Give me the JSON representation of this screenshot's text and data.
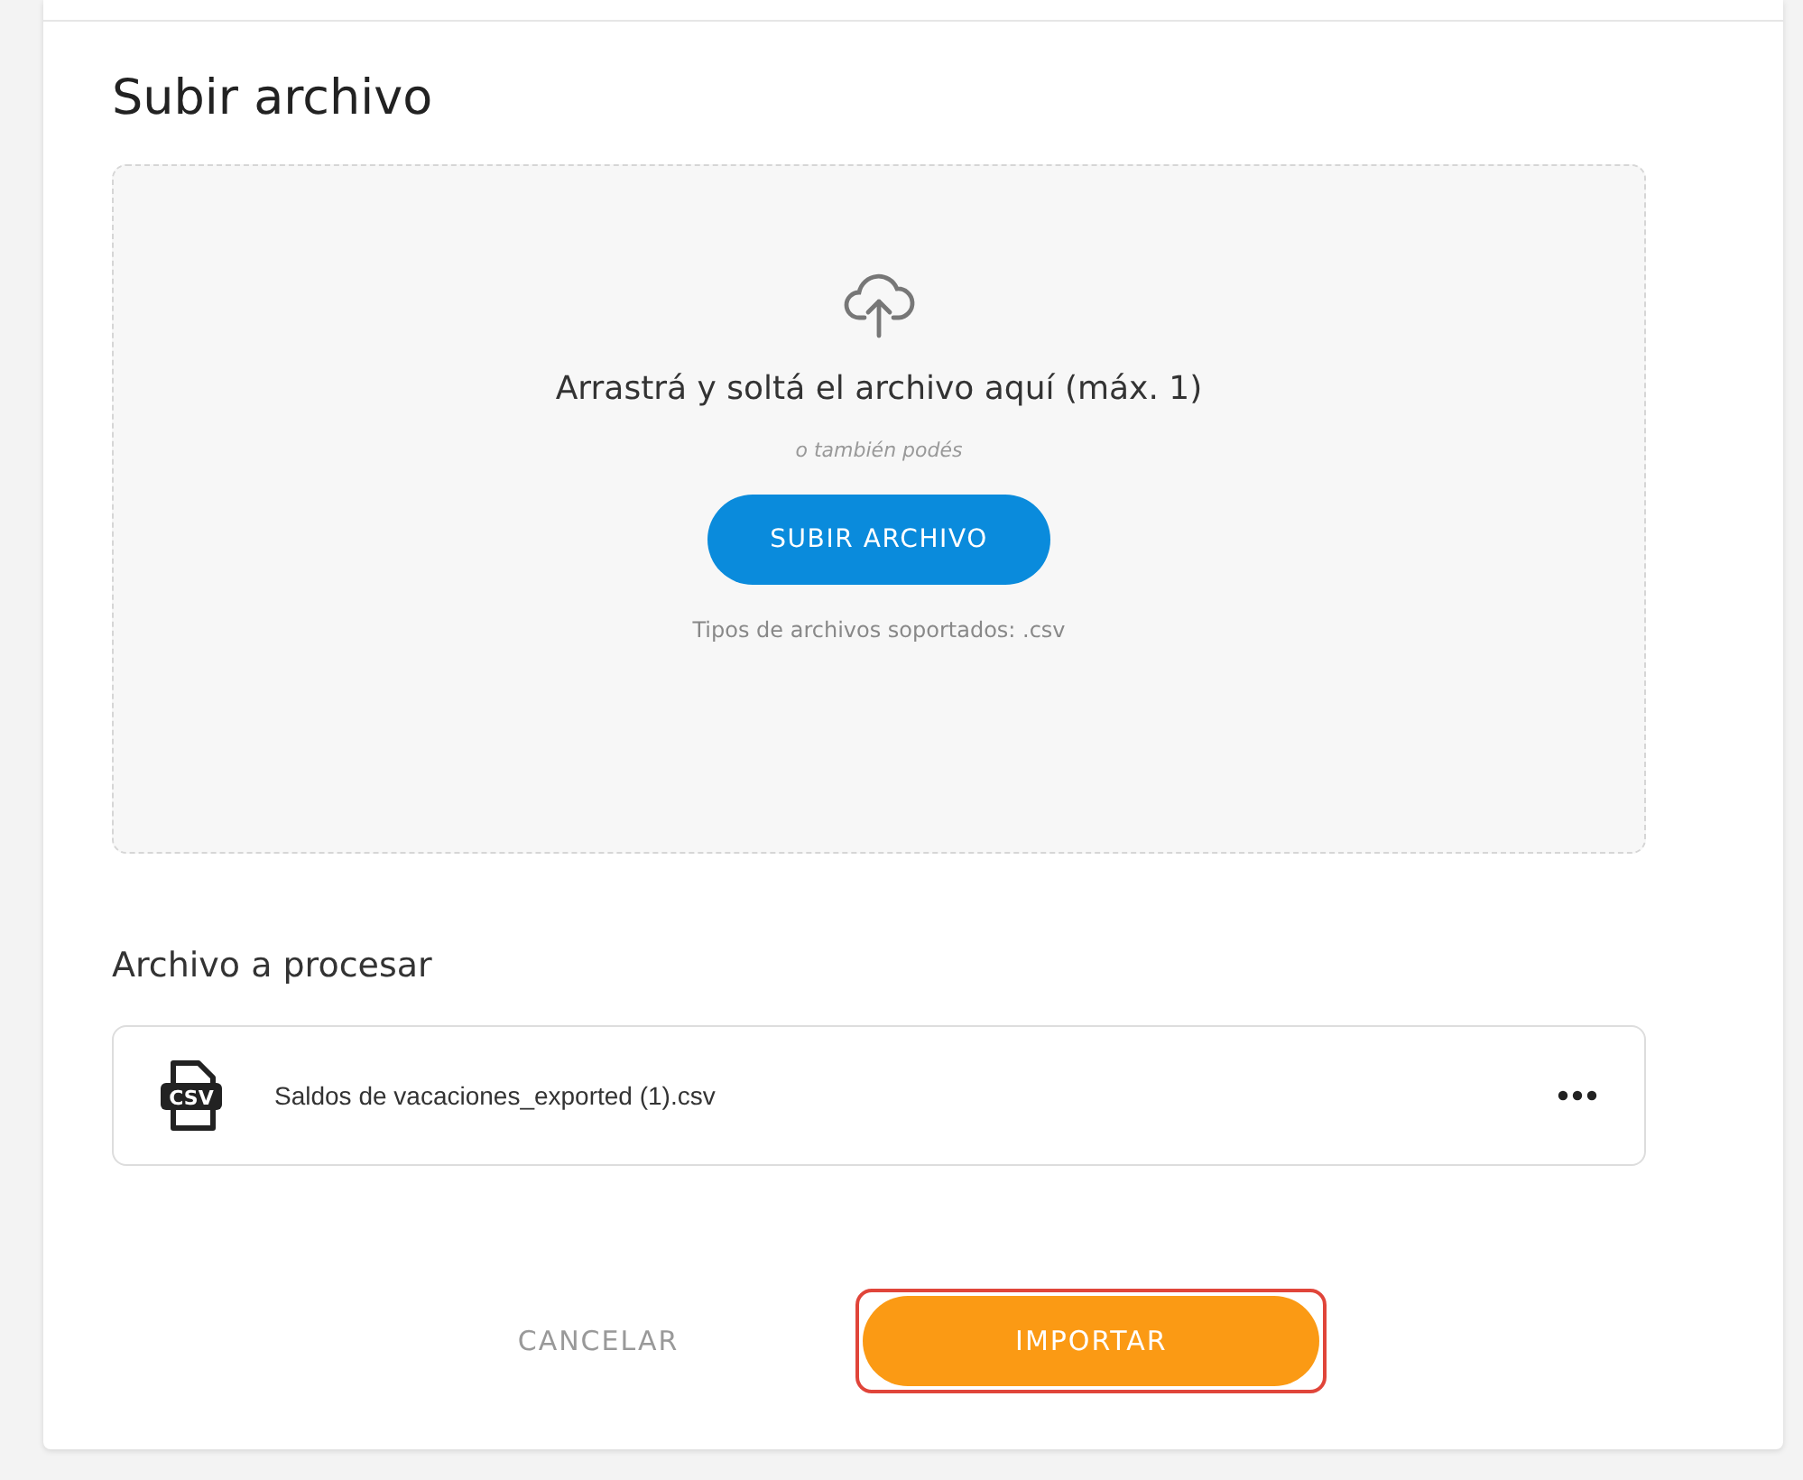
{
  "title": "Subir archivo",
  "dropzone": {
    "message": "Arrastrá y soltá el archivo aquí (máx. 1)",
    "alternative": "o también podés",
    "button": "SUBIR ARCHIVO",
    "supported": "Tipos de archivos soportados: .csv"
  },
  "files_heading": "Archivo a procesar",
  "files": [
    {
      "name": "Saldos de vacaciones_exported (1).csv",
      "icon_label": "CSV"
    }
  ],
  "actions": [
    {
      "label": "CANCELAR",
      "kind": "text",
      "highlighted": false
    },
    {
      "label": "IMPORTAR",
      "kind": "primary",
      "highlighted": true
    }
  ]
}
